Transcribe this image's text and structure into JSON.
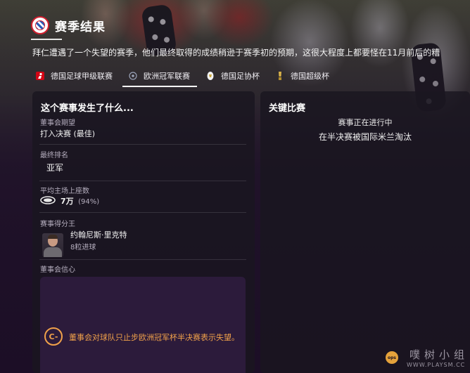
{
  "header": {
    "title": "赛季结果",
    "summary": "拜仁遭遇了一个失望的赛季，他们最终取得的成绩稍逊于赛季初的预期，这很大程度上都要怪在11月前后的糟"
  },
  "tabs": [
    {
      "label": "德国足球甲级联赛",
      "icon": "bundesliga-icon"
    },
    {
      "label": "欧洲冠军联赛",
      "icon": "champions-league-icon",
      "active": true
    },
    {
      "label": "德国足协杯",
      "icon": "dfb-pokal-icon"
    },
    {
      "label": "德国超级杯",
      "icon": "supercup-icon"
    }
  ],
  "left_panel": {
    "title": "这个赛事发生了什么...",
    "board_expectation": {
      "label": "董事会期望",
      "value": "打入决赛 (最佳)"
    },
    "final_position": {
      "label": "最终排名",
      "value": "亚军"
    },
    "avg_attendance": {
      "label": "平均主场上座数",
      "value": "7万",
      "percent": "(94%)"
    },
    "top_scorer": {
      "label": "赛事得分王",
      "name": "约翰尼斯·里克特",
      "goals": "8粒进球"
    },
    "board_confidence": {
      "label": "董事会信心",
      "icon_text": "C-",
      "message": "董事会对球队只止步欧洲冠军杯半决赛表示失望。"
    }
  },
  "right_panel": {
    "title": "关键比赛",
    "status": "赛事正在进行中",
    "result": "在半决赛被国际米兰淘汰"
  },
  "watermark": {
    "badge": "ops",
    "brand": "噗树小组",
    "url": "WWW.PLAYSM.CC"
  },
  "colors": {
    "accent_orange": "#f0a14a",
    "panel_bg": "#1a1620",
    "confidence_bg": "#2c1b3b",
    "club_red": "#d01f2f"
  }
}
